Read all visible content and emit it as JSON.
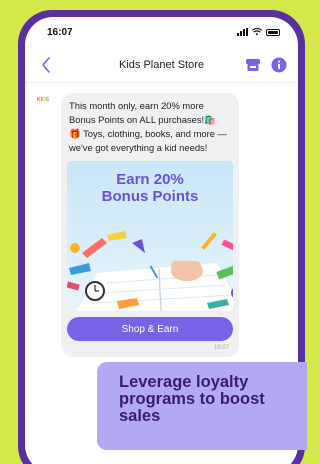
{
  "status_bar": {
    "time": "16:07"
  },
  "navbar": {
    "title": "Kids Planet Store"
  },
  "sender": {
    "logo_text": "KIDS"
  },
  "message": {
    "line1": "This month only, earn 20% more Bonus Points on ALL purchases!🛍️",
    "line2": "🎁 Toys, clothing, books, and more — we've got everything a kid needs!"
  },
  "promo": {
    "title_line1": "Earn 20%",
    "title_line2": "Bonus Points"
  },
  "cta": {
    "label": "Shop & Earn"
  },
  "timestamp": "16:07",
  "overlay": {
    "text": "Leverage loyalty programs to boost sales"
  },
  "icons": {
    "back": "chevron-left-icon",
    "store": "store-icon",
    "info": "info-icon"
  },
  "colors": {
    "background": "#d4e84a",
    "phone_frame": "#5a2fa0",
    "accent": "#7a62e6",
    "overlay": "#b3a8f2",
    "overlay_text": "#3a1d72"
  }
}
